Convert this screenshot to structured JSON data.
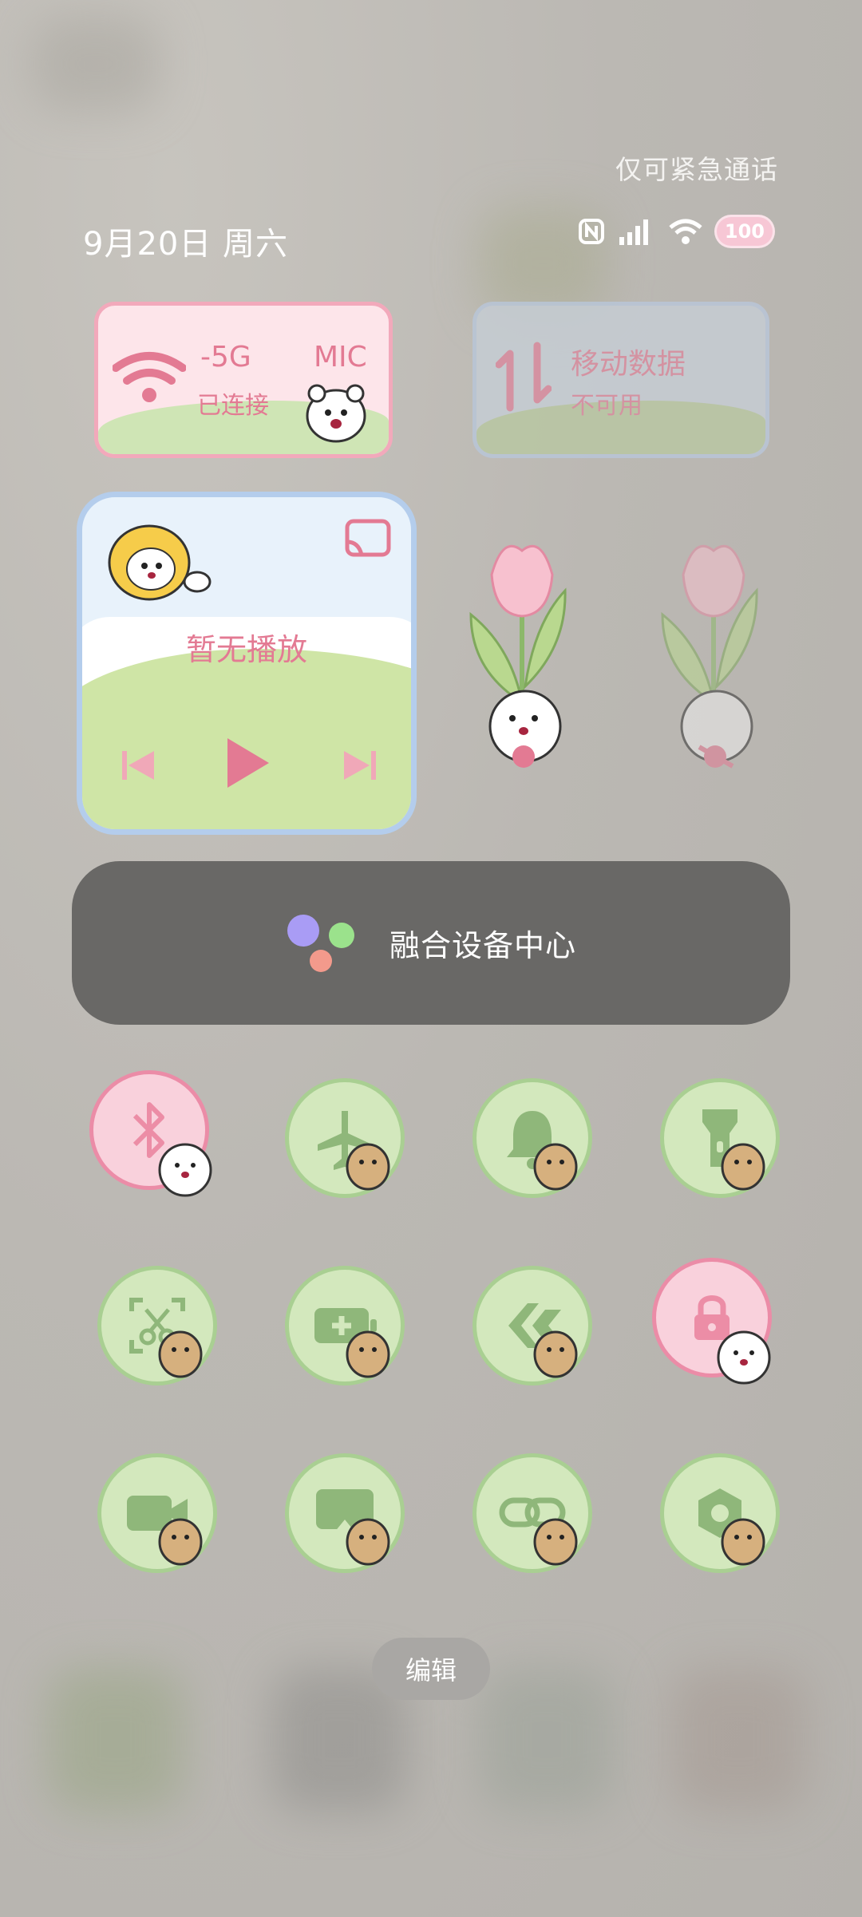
{
  "status_bar": {
    "emergency_text": "仅可紧急通话",
    "date": "9月20日 周六",
    "battery": "100"
  },
  "wifi_tile": {
    "label": "-5G",
    "label_suffix": "MIC",
    "status": "已连接"
  },
  "mobile_tile": {
    "label": "移动数据",
    "status": "不可用"
  },
  "media_player": {
    "status": "暂无播放"
  },
  "fusion_center": {
    "label": "融合设备中心"
  },
  "toggles": [
    {
      "icon": "bluetooth-icon",
      "active": true
    },
    {
      "icon": "airplane-icon",
      "active": false
    },
    {
      "icon": "bell-icon",
      "active": false
    },
    {
      "icon": "flashlight-icon",
      "active": false
    },
    {
      "icon": "screenshot-icon",
      "active": false
    },
    {
      "icon": "battery-saver-icon",
      "active": false
    },
    {
      "icon": "share-icon",
      "active": false
    },
    {
      "icon": "rotation-lock-icon",
      "active": true
    },
    {
      "icon": "screen-record-icon",
      "active": false
    },
    {
      "icon": "cast-icon",
      "active": false
    },
    {
      "icon": "link-icon",
      "active": false
    },
    {
      "icon": "settings-icon",
      "active": false
    }
  ],
  "edit_button": {
    "label": "编辑"
  },
  "colors": {
    "accent_pink": "#e37a93",
    "green": "#a9cf92",
    "pink_border": "#eb8ca7"
  }
}
